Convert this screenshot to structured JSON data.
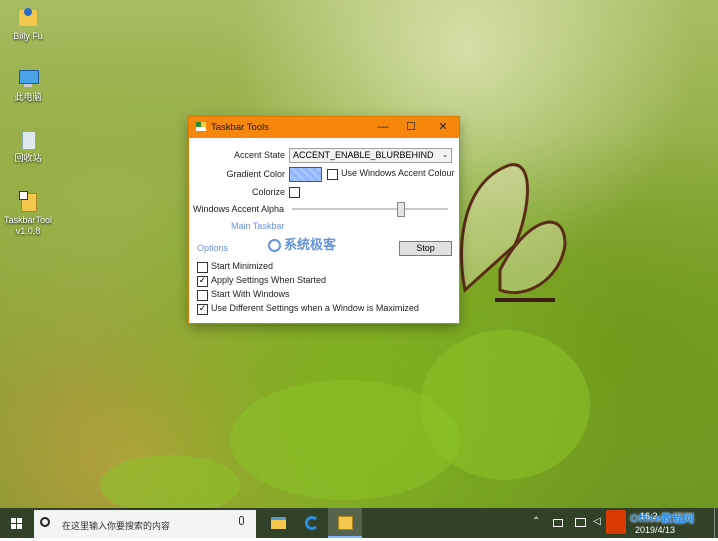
{
  "desktop": {
    "icons": [
      {
        "label": "Billy Fu"
      },
      {
        "label": "此电脑"
      },
      {
        "label": "回收站"
      },
      {
        "label": "TaskbarTool\nv1.0.8"
      }
    ]
  },
  "window": {
    "title": "Taskbar Tools",
    "controls": {
      "minimize": "—",
      "maximize": "☐",
      "close": "✕"
    },
    "accent_state_label": "Accent State",
    "accent_state_value": "ACCENT_ENABLE_BLURBEHIND",
    "gradient_color_label": "Gradient Color",
    "gradient_color_hex": "#8fb6ff",
    "use_windows_accent_label": "Use Windows Accent Colour",
    "use_windows_accent_checked": false,
    "colorize_label": "Colorize",
    "colorize_checked": false,
    "windows_accent_alpha_label": "Windows Accent Alpha",
    "alpha_slider_fraction": 0.7,
    "main_taskbar_link": "Main Taskbar",
    "options_link": "Options",
    "stop_button": "Stop",
    "checkboxes": [
      {
        "label": "Start Minimized",
        "checked": false
      },
      {
        "label": "Apply Settings When Started",
        "checked": true
      },
      {
        "label": "Start With Windows",
        "checked": false
      },
      {
        "label": "Use Different Settings when a Window is Maximized",
        "checked": true
      }
    ],
    "watermark": "系统极客"
  },
  "taskbar": {
    "search_placeholder": "在这里输入你要搜索的内容",
    "time": "16:2",
    "date": "2019/4/13",
    "office_watermark": "Office教程网"
  },
  "colors": {
    "title_bar": "#f5870d",
    "taskbar_bg": "#1c2b10"
  }
}
